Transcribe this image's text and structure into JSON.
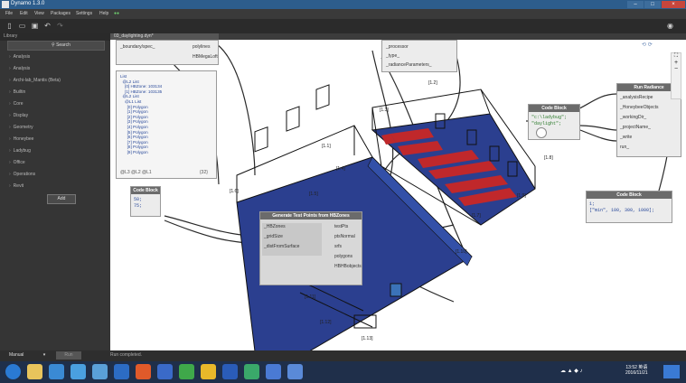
{
  "window": {
    "title": "Dynamo 1.3.0",
    "min": "–",
    "max": "□",
    "close": "×"
  },
  "menu": [
    "File",
    "Edit",
    "View",
    "Packages",
    "Settings",
    "Help"
  ],
  "library": {
    "header": "Library",
    "search_placeholder": "Search",
    "items": [
      "Analysis",
      "Analysis",
      "Archi-lab_Mantis (Beta)",
      "Builtin",
      "Core",
      "Display",
      "Geometry",
      "Honeybee",
      "Ladybug",
      "Office",
      "Operations",
      "Revit"
    ],
    "add_button": "Add"
  },
  "tab": {
    "label": "03_daylighting.dyn*"
  },
  "watch": {
    "lines": [
      "List",
      "  @L2 List",
      "    [0] HBZone: 103134",
      "    [1] HBZone: 103135",
      "  @L2 List",
      "    @L1 List",
      "      [0] Polygon",
      "      [1] Polygon",
      "      [2] Polygon",
      "      [3] Polygon",
      "      [4] Polygon",
      "      [5] Polygon",
      "      [6] Polygon",
      "      [7] Polygon",
      "      [8] Polygon",
      "      [9] Polygon"
    ],
    "footer_left": "@L3 @L2 @L1",
    "footer_right": "{32}"
  },
  "node_generate": {
    "title": "Generate Test Points from HBZones",
    "inputs": [
      "_HBZones",
      "_gridSize",
      "_distFromSurface"
    ],
    "outputs": [
      "testPts",
      "ptsNormal",
      "srfs",
      "polygons",
      "HBHBobjects"
    ]
  },
  "node_top_left": {
    "inputs": [
      "_boundary/spec_"
    ],
    "outputs": [
      "polylines",
      "HBMegaLoft"
    ]
  },
  "node_top_mid": {
    "inputs": [
      "_processor",
      "_type_",
      "_radianceParameters_"
    ]
  },
  "codeblock_small": {
    "title": "Code Block",
    "lines": [
      "50;",
      "75;"
    ]
  },
  "codeblock_mid": {
    "title": "Code Block",
    "lines": [
      "\"c:\\ladybug\";",
      "\"daylight\";"
    ]
  },
  "codeblock_right": {
    "title": "Code Block",
    "lines": [
      "1;",
      "[\"min\", 100, 300, 1000];"
    ]
  },
  "node_run": {
    "title": "Run Radiance",
    "inputs": [
      "_analysisRecipe",
      "_HoneybeeObjects",
      "_workingDir_",
      "_projectName_",
      "_write",
      "run_"
    ]
  },
  "zone_labels": [
    "[1.1]",
    "[1.2]",
    "[1.3]",
    "[1.4]",
    "[1.5]",
    "[1.6]",
    "[1.7]",
    "[1.8]",
    "[1.9]",
    "[1.10]",
    "[1.11]",
    "[1.12]",
    "[1.13]"
  ],
  "view_controls": {
    "zoom_in": "+",
    "zoom_out": "−",
    "fit": "⛶"
  },
  "bottom": {
    "run_mode": "Manual",
    "run_button": "Run",
    "status": "Run completed."
  },
  "tray": {
    "time": "13:52 英语",
    "date": "2016/11/21"
  },
  "colors": {
    "slab": "#2b3f8f",
    "hot": "#c0282b",
    "grid_line": "#1a1a1a",
    "node_head": "#6b6b6b"
  }
}
